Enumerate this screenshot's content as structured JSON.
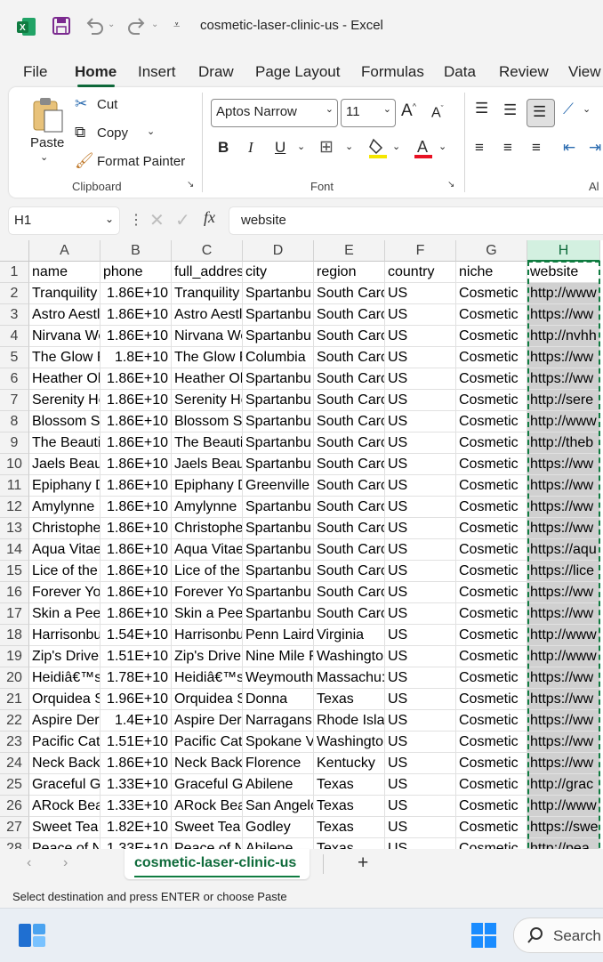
{
  "window": {
    "title": "cosmetic-laser-clinic-us  -  Excel"
  },
  "menu": {
    "tabs": [
      "File",
      "Home",
      "Insert",
      "Draw",
      "Page Layout",
      "Formulas",
      "Data",
      "Review",
      "View"
    ],
    "active": "Home"
  },
  "ribbon": {
    "clipboard": {
      "paste": "Paste",
      "cut": "Cut",
      "copy": "Copy",
      "format_painter": "Format Painter",
      "group_label": "Clipboard"
    },
    "font": {
      "family": "Aptos Narrow",
      "size": "11",
      "bold": "B",
      "italic": "I",
      "underline": "U",
      "group_label": "Font"
    },
    "alignment": {
      "group_label": "Al"
    }
  },
  "formula_bar": {
    "name_box": "H1",
    "fx": "fx",
    "content": "website"
  },
  "grid": {
    "columns": [
      "A",
      "B",
      "C",
      "D",
      "E",
      "F",
      "G",
      "H"
    ],
    "selected_column": "H",
    "rows": [
      {
        "n": "1",
        "cells": [
          "name",
          "phone",
          "full_addres",
          "city",
          "region",
          "country",
          "niche",
          "website"
        ]
      },
      {
        "n": "2",
        "cells": [
          "Tranquility",
          "1.86E+10",
          "Tranquility",
          "Spartanbu",
          "South Caro",
          "US",
          "Cosmetic",
          "http://www"
        ]
      },
      {
        "n": "3",
        "cells": [
          "Astro Aestl",
          "1.86E+10",
          "Astro Aestl",
          "Spartanbu",
          "South Caro",
          "US",
          "Cosmetic",
          "https://ww"
        ]
      },
      {
        "n": "4",
        "cells": [
          "Nirvana We",
          "1.86E+10",
          "Nirvana We",
          "Spartanbu",
          "South Caro",
          "US",
          "Cosmetic",
          "http://nvhh"
        ]
      },
      {
        "n": "5",
        "cells": [
          "The Glow F",
          "1.8E+10",
          "The Glow F",
          "Columbia",
          "South Caro",
          "US",
          "Cosmetic",
          "https://ww"
        ]
      },
      {
        "n": "6",
        "cells": [
          "Heather Ol",
          "1.86E+10",
          "Heather Ol",
          "Spartanbu",
          "South Caro",
          "US",
          "Cosmetic",
          "https://ww"
        ]
      },
      {
        "n": "7",
        "cells": [
          "Serenity He",
          "1.86E+10",
          "Serenity He",
          "Spartanbu",
          "South Caro",
          "US",
          "Cosmetic",
          "http://sere"
        ]
      },
      {
        "n": "8",
        "cells": [
          "Blossom Sa",
          "1.86E+10",
          "Blossom Sa",
          "Spartanbu",
          "South Caro",
          "US",
          "Cosmetic",
          "http://www"
        ]
      },
      {
        "n": "9",
        "cells": [
          "The Beauti",
          "1.86E+10",
          "The Beauti",
          "Spartanbu",
          "South Caro",
          "US",
          "Cosmetic",
          "http://theb"
        ]
      },
      {
        "n": "10",
        "cells": [
          "Jaels Beau",
          "1.86E+10",
          "Jaels Beau",
          "Spartanbu",
          "South Caro",
          "US",
          "Cosmetic",
          "https://ww"
        ]
      },
      {
        "n": "11",
        "cells": [
          "Epiphany D",
          "1.86E+10",
          "Epiphany D",
          "Greenville",
          "South Caro",
          "US",
          "Cosmetic",
          "https://ww"
        ]
      },
      {
        "n": "12",
        "cells": [
          "Amylynne F",
          "1.86E+10",
          "Amylynne F",
          "Spartanbu",
          "South Caro",
          "US",
          "Cosmetic",
          "https://ww"
        ]
      },
      {
        "n": "13",
        "cells": [
          "Christophe",
          "1.86E+10",
          "Christophe",
          "Spartanbu",
          "South Caro",
          "US",
          "Cosmetic",
          "https://ww"
        ]
      },
      {
        "n": "14",
        "cells": [
          "Aqua Vitae",
          "1.86E+10",
          "Aqua Vitae",
          "Spartanbu",
          "South Caro",
          "US",
          "Cosmetic",
          "https://aqu"
        ]
      },
      {
        "n": "15",
        "cells": [
          "Lice of the",
          "1.86E+10",
          "Lice of the",
          "Spartanbu",
          "South Caro",
          "US",
          "Cosmetic",
          "https://lice"
        ]
      },
      {
        "n": "16",
        "cells": [
          "Forever Yo",
          "1.86E+10",
          "Forever Yo",
          "Spartanbu",
          "South Caro",
          "US",
          "Cosmetic",
          "https://ww"
        ]
      },
      {
        "n": "17",
        "cells": [
          "Skin a Peel",
          "1.86E+10",
          "Skin a Peel",
          "Spartanbu",
          "South Caro",
          "US",
          "Cosmetic",
          "https://ww"
        ]
      },
      {
        "n": "18",
        "cells": [
          "Harrisonbu",
          "1.54E+10",
          "Harrisonbu",
          "Penn Laird",
          "Virginia",
          "US",
          "Cosmetic",
          "http://www"
        ]
      },
      {
        "n": "19",
        "cells": [
          "Zip's Drive",
          "1.51E+10",
          "Zip's Drive",
          "Nine Mile F",
          "Washingto",
          "US",
          "Cosmetic",
          "http://www"
        ]
      },
      {
        "n": "20",
        "cells": [
          "Heidiâ€™s",
          "1.78E+10",
          "Heidiâ€™s",
          "Weymouth",
          "Massachu:",
          "US",
          "Cosmetic",
          "https://ww"
        ]
      },
      {
        "n": "21",
        "cells": [
          "Orquidea S",
          "1.96E+10",
          "Orquidea S",
          "Donna",
          "Texas",
          "US",
          "Cosmetic",
          "https://ww"
        ]
      },
      {
        "n": "22",
        "cells": [
          "Aspire Der",
          "1.4E+10",
          "Aspire Der",
          "Narragans",
          "Rhode Islar",
          "US",
          "Cosmetic",
          "https://ww"
        ]
      },
      {
        "n": "23",
        "cells": [
          "Pacific Cat",
          "1.51E+10",
          "Pacific Cat",
          "Spokane V",
          "Washingto",
          "US",
          "Cosmetic",
          "https://ww"
        ]
      },
      {
        "n": "24",
        "cells": [
          "Neck Back",
          "1.86E+10",
          "Neck Back",
          "Florence",
          "Kentucky",
          "US",
          "Cosmetic",
          "https://ww"
        ]
      },
      {
        "n": "25",
        "cells": [
          "Graceful G",
          "1.33E+10",
          "Graceful G",
          "Abilene",
          "Texas",
          "US",
          "Cosmetic",
          "http://grac"
        ]
      },
      {
        "n": "26",
        "cells": [
          "ARock Bea",
          "1.33E+10",
          "ARock Bea",
          "San Angelo",
          "Texas",
          "US",
          "Cosmetic",
          "http://www"
        ]
      },
      {
        "n": "27",
        "cells": [
          "Sweet Tea",
          "1.82E+10",
          "Sweet Tea",
          "Godley",
          "Texas",
          "US",
          "Cosmetic",
          "https://swe"
        ]
      },
      {
        "n": "28",
        "cells": [
          "Peace of N",
          "1.33E+10",
          "Peace of N",
          "Abilene",
          "Texas",
          "US",
          "Cosmetic",
          "http://pea"
        ]
      }
    ]
  },
  "sheets": {
    "active": "cosmetic-laser-clinic-us",
    "add": "+"
  },
  "status": {
    "message": "Select destination and press ENTER or choose Paste"
  },
  "taskbar": {
    "search": "Search"
  },
  "colors": {
    "accent": "#107c41",
    "selection": "#d0d0d0"
  }
}
